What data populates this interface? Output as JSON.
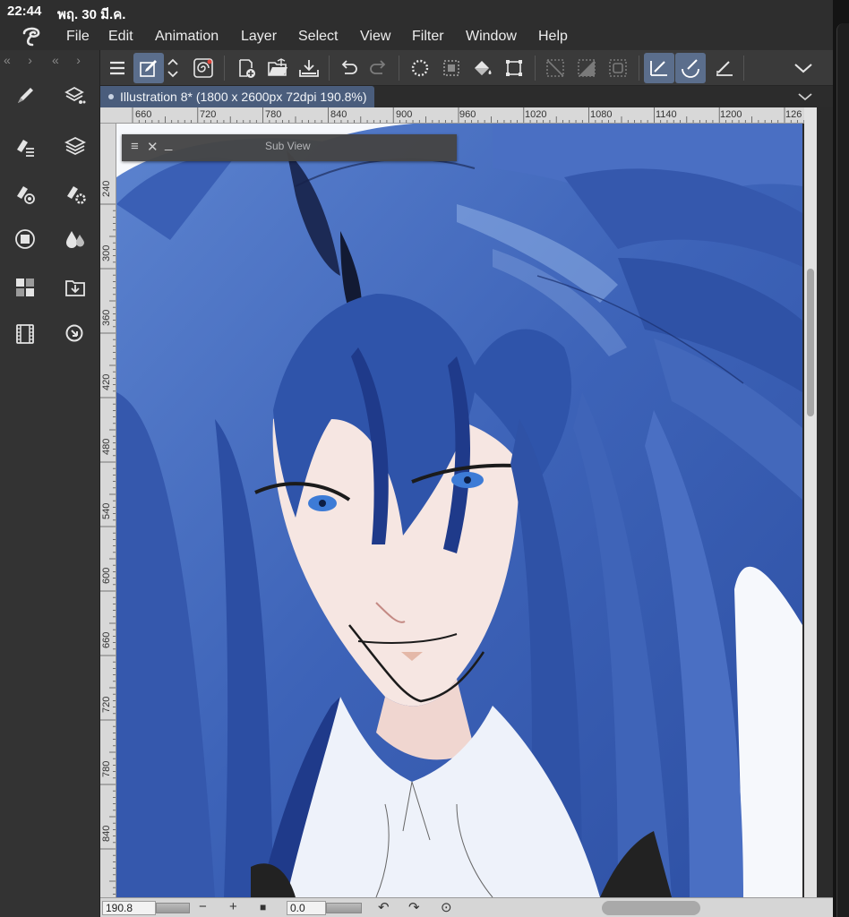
{
  "status_bar": {
    "time": "22:44",
    "date": "พฤ. 30 มี.ค."
  },
  "menu": {
    "items": [
      "File",
      "Edit",
      "Animation",
      "Layer",
      "Select",
      "View",
      "Filter",
      "Window",
      "Help"
    ]
  },
  "left_panel": {
    "collapse_left": "«   ›",
    "collapse_right": "«   ›",
    "tools": [
      "pen-tool-icon",
      "layer-property-icon",
      "sub-tool-icon",
      "layer-icon",
      "tool-property-icon",
      "sub-tool-detail-icon",
      "navigator-icon",
      "color-wheel-icon",
      "material-icon",
      "import-icon",
      "timeline-icon",
      "search-icon"
    ]
  },
  "command_bar": {
    "icons": [
      "menu-icon",
      "edit-mode-icon",
      "expand-icon",
      "spiral-icon",
      "new-canvas-icon",
      "open-folder-icon",
      "save-icon",
      "undo-icon",
      "redo-icon",
      "lasso-selection-icon",
      "select-all-icon",
      "fill-icon",
      "transform-icon",
      "deselect-icon",
      "invert-selection-icon",
      "selection-border-icon",
      "ruler-snap-icon",
      "curve-ruler-icon",
      "special-ruler-icon",
      "collapse-chevron-icon"
    ]
  },
  "document": {
    "tab_title": "Illustration 8* (1800 x 2600px 72dpi 190.8%)"
  },
  "ruler_top": [
    "660",
    "720",
    "780",
    "840",
    "900",
    "960",
    "1020",
    "1080",
    "1140",
    "1200",
    "126"
  ],
  "ruler_left": [
    "240",
    "300",
    "360",
    "420",
    "480",
    "540",
    "600",
    "660",
    "720",
    "780",
    "840"
  ],
  "sub_view": {
    "title": "Sub View"
  },
  "bottom_bar": {
    "zoom": "190.8",
    "zoom_out": "−",
    "zoom_in": "+",
    "rotation": "0.0"
  },
  "colors": {
    "hair_blue": "#3d63b8",
    "hair_dark": "#1f3a8a",
    "hair_highlight": "#6f93d6",
    "skin": "#f6e6e2",
    "shirt": "#eef2fa",
    "eye": "#3d7bd6",
    "ui_accent": "#5b6e8c"
  }
}
